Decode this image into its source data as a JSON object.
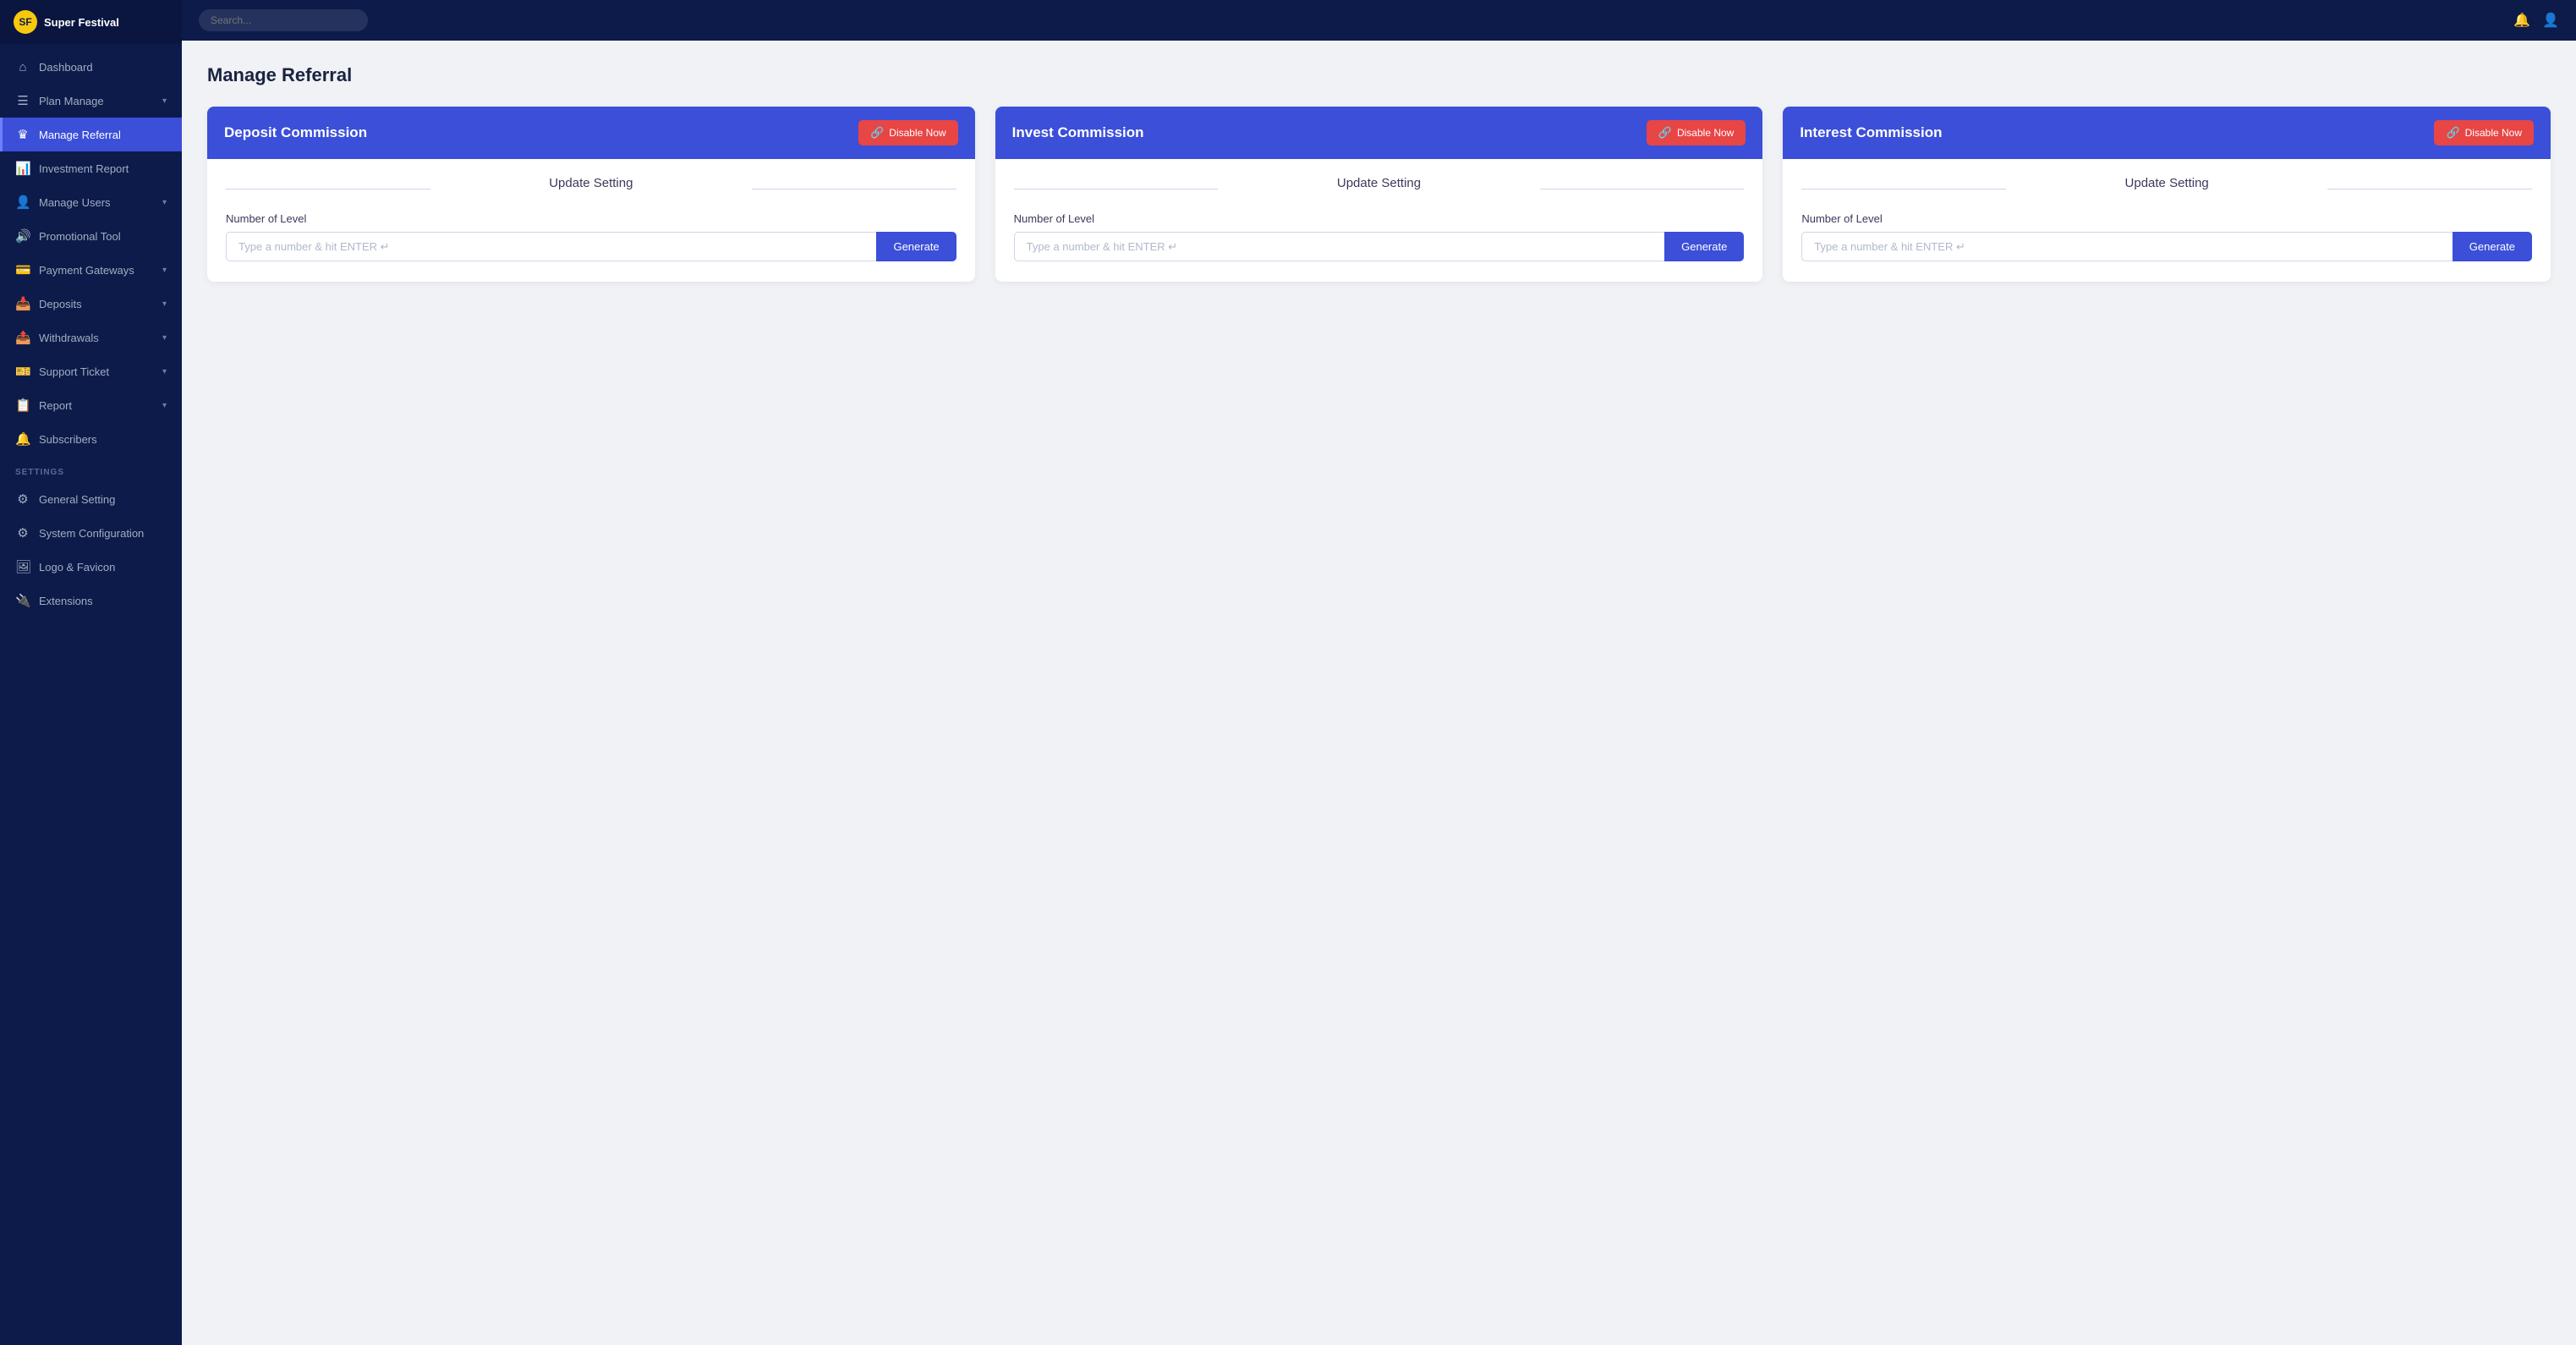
{
  "sidebar": {
    "logo": {
      "icon_text": "SF",
      "text": "Super Festival"
    },
    "nav_items": [
      {
        "id": "dashboard",
        "icon": "⌂",
        "label": "Dashboard",
        "active": false,
        "has_chevron": false
      },
      {
        "id": "plan-manage",
        "icon": "☰",
        "label": "Plan Manage",
        "active": false,
        "has_chevron": true
      },
      {
        "id": "manage-referral",
        "icon": "♛",
        "label": "Manage Referral",
        "active": true,
        "has_chevron": false
      },
      {
        "id": "investment-report",
        "icon": "📊",
        "label": "Investment Report",
        "active": false,
        "has_chevron": false
      },
      {
        "id": "manage-users",
        "icon": "👤",
        "label": "Manage Users",
        "active": false,
        "has_chevron": true
      },
      {
        "id": "promotional-tool",
        "icon": "🔊",
        "label": "Promotional Tool",
        "active": false,
        "has_chevron": false
      },
      {
        "id": "payment-gateways",
        "icon": "💳",
        "label": "Payment Gateways",
        "active": false,
        "has_chevron": true
      },
      {
        "id": "deposits",
        "icon": "📥",
        "label": "Deposits",
        "active": false,
        "has_chevron": true
      },
      {
        "id": "withdrawals",
        "icon": "📤",
        "label": "Withdrawals",
        "active": false,
        "has_chevron": true
      },
      {
        "id": "support-ticket",
        "icon": "🎫",
        "label": "Support Ticket",
        "active": false,
        "has_chevron": true
      },
      {
        "id": "report",
        "icon": "📋",
        "label": "Report",
        "active": false,
        "has_chevron": true
      },
      {
        "id": "subscribers",
        "icon": "🔔",
        "label": "Subscribers",
        "active": false,
        "has_chevron": false
      }
    ],
    "settings_label": "SETTINGS",
    "settings_items": [
      {
        "id": "general-setting",
        "icon": "⚙",
        "label": "General Setting",
        "active": false
      },
      {
        "id": "system-configuration",
        "icon": "⚙",
        "label": "System Configuration",
        "active": false
      },
      {
        "id": "logo-favicon",
        "icon": "🖼",
        "label": "Logo & Favicon",
        "active": false
      },
      {
        "id": "extensions",
        "icon": "🔌",
        "label": "Extensions",
        "active": false
      }
    ]
  },
  "topbar": {
    "search_placeholder": "Search..."
  },
  "page": {
    "title": "Manage Referral"
  },
  "cards": [
    {
      "id": "deposit-commission",
      "title": "Deposit Commission",
      "disable_btn_label": "Disable Now",
      "update_setting_label": "Update Setting",
      "field_label": "Number of Level",
      "input_placeholder": "Type a number & hit ENTER ↵",
      "generate_btn_label": "Generate"
    },
    {
      "id": "invest-commission",
      "title": "Invest Commission",
      "disable_btn_label": "Disable Now",
      "update_setting_label": "Update Setting",
      "field_label": "Number of Level",
      "input_placeholder": "Type a number & hit ENTER ↵",
      "generate_btn_label": "Generate"
    },
    {
      "id": "interest-commission",
      "title": "Interest Commission",
      "disable_btn_label": "Disable Now",
      "update_setting_label": "Update Setting",
      "field_label": "Number of Level",
      "input_placeholder": "Type a number & hit ENTER ↵",
      "generate_btn_label": "Generate"
    }
  ],
  "colors": {
    "sidebar_bg": "#0d1b4b",
    "card_header_bg": "#3b4fd8",
    "disable_btn_bg": "#e84545",
    "generate_btn_bg": "#3b4fd8",
    "active_nav_bg": "#3b4fd8"
  }
}
